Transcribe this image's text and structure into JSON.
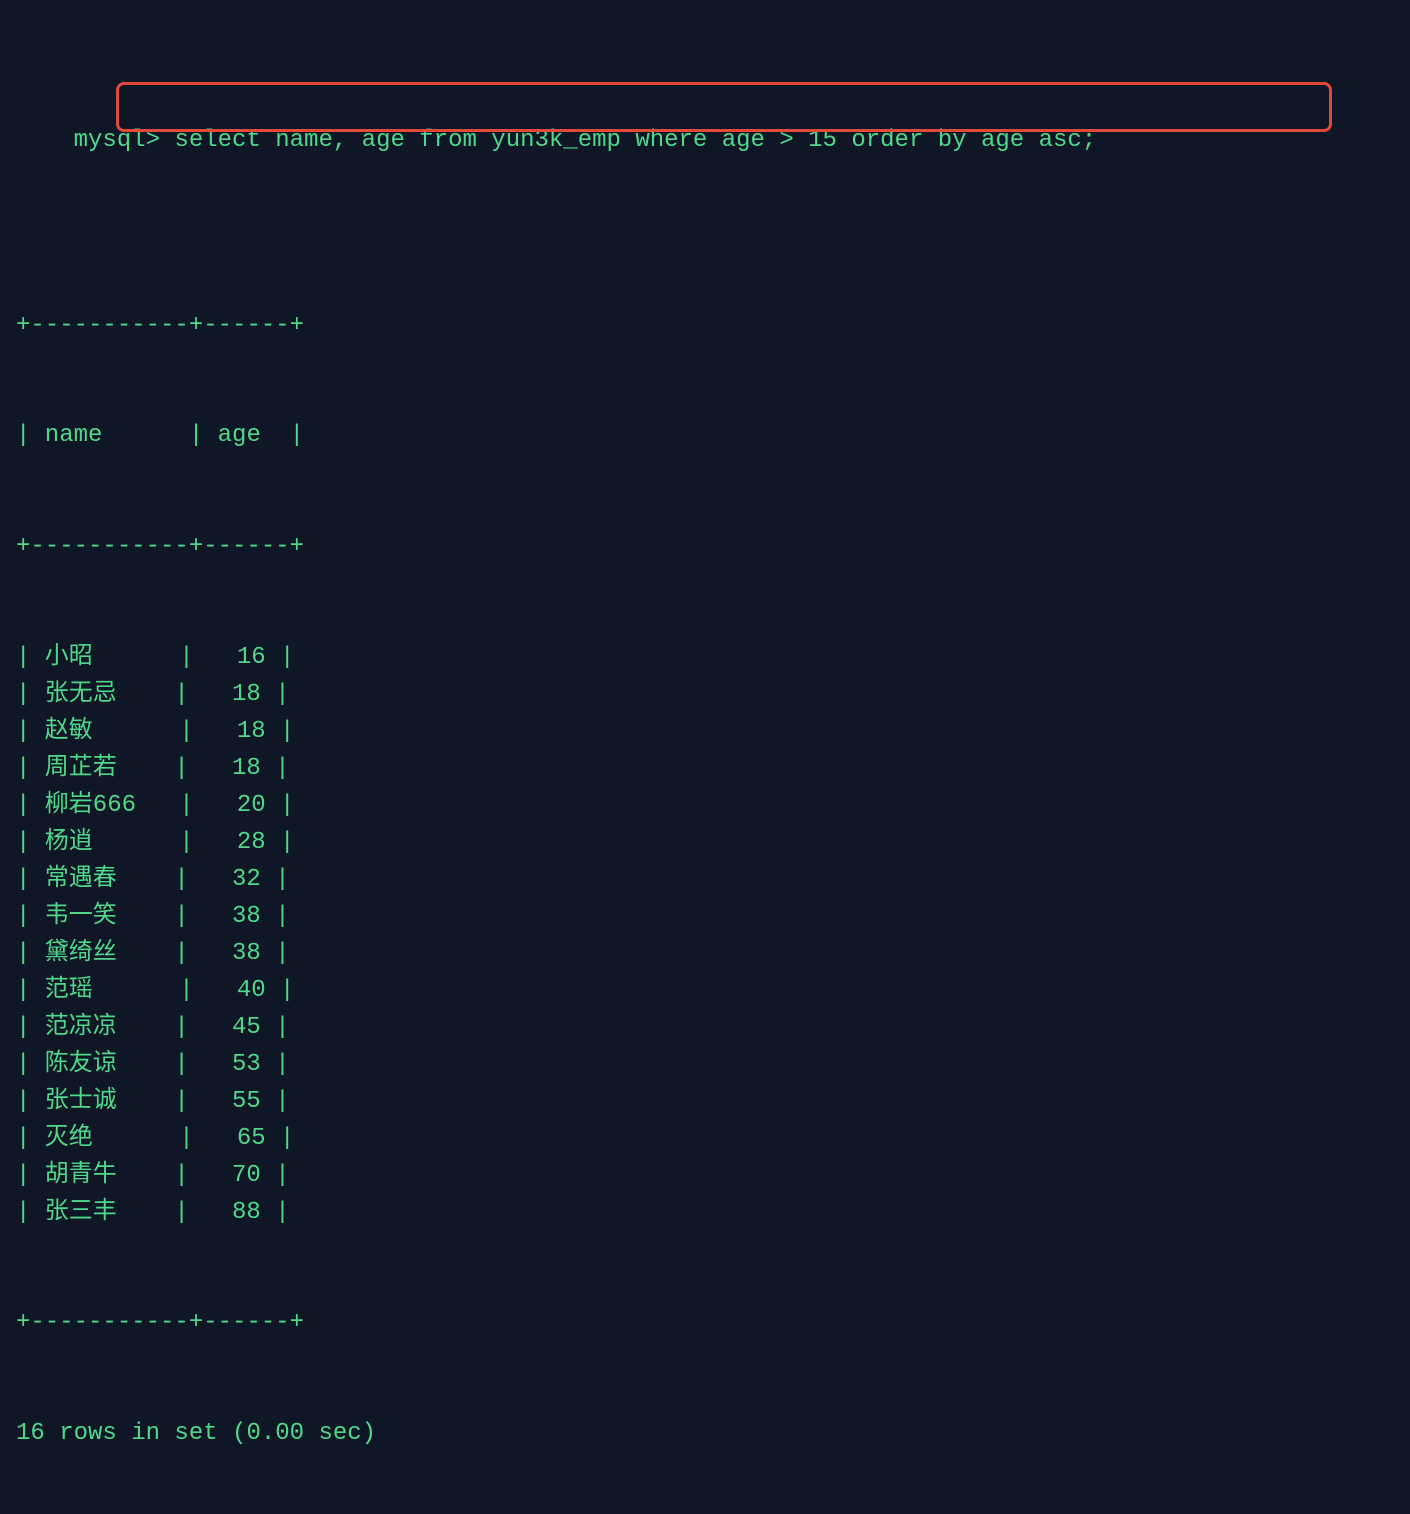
{
  "prompt": "mysql>",
  "query": "select name, age from yun3k_emp where age > 15 order by age asc;",
  "separator": "+-----------+------+",
  "columns": [
    "name",
    "age"
  ],
  "name_inner_width": 11,
  "age_inner_width": 6,
  "rows": [
    {
      "name": "小昭",
      "age": 16
    },
    {
      "name": "张无忌",
      "age": 18
    },
    {
      "name": "赵敏",
      "age": 18
    },
    {
      "name": "周芷若",
      "age": 18
    },
    {
      "name": "柳岩666",
      "age": 20
    },
    {
      "name": "杨逍",
      "age": 28
    },
    {
      "name": "常遇春",
      "age": 32
    },
    {
      "name": "韦一笑",
      "age": 38
    },
    {
      "name": "黛绮丝",
      "age": 38
    },
    {
      "name": "范瑶",
      "age": 40
    },
    {
      "name": "范凉凉",
      "age": 45
    },
    {
      "name": "陈友谅",
      "age": 53
    },
    {
      "name": "张士诚",
      "age": 55
    },
    {
      "name": "灭绝",
      "age": 65
    },
    {
      "name": "胡青牛",
      "age": 70
    },
    {
      "name": "张三丰",
      "age": 88
    }
  ],
  "status": "16 rows in set (0.00 sec)",
  "chart_data": {
    "type": "table",
    "title": "select name, age from yun3k_emp where age > 15 order by age asc;",
    "columns": [
      "name",
      "age"
    ],
    "rows": [
      [
        "小昭",
        16
      ],
      [
        "张无忌",
        18
      ],
      [
        "赵敏",
        18
      ],
      [
        "周芷若",
        18
      ],
      [
        "柳岩666",
        20
      ],
      [
        "杨逍",
        28
      ],
      [
        "常遇春",
        32
      ],
      [
        "韦一笑",
        38
      ],
      [
        "黛绮丝",
        38
      ],
      [
        "范瑶",
        40
      ],
      [
        "范凉凉",
        45
      ],
      [
        "陈友谅",
        53
      ],
      [
        "张士诚",
        55
      ],
      [
        "灭绝",
        65
      ],
      [
        "胡青牛",
        70
      ],
      [
        "张三丰",
        88
      ]
    ]
  }
}
